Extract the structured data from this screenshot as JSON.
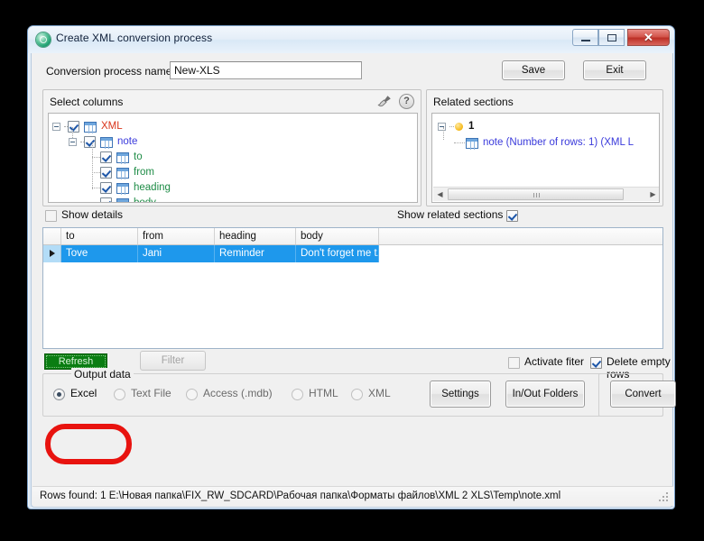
{
  "window": {
    "title": "Create XML conversion process",
    "app_icon": "app-circle-icon",
    "minimize_label": "",
    "maximize_label": "",
    "close_label": "✕"
  },
  "toolbar": {
    "conversion_label": "Conversion process name:",
    "conversion_value": "New-XLS",
    "save_label": "Save",
    "exit_label": "Exit"
  },
  "columns_panel": {
    "header": "Select columns",
    "brush_icon": "brush-icon",
    "help_icon": "help-icon",
    "tree": [
      {
        "label": "XML",
        "color": "#d9341b",
        "depth": 0,
        "checked": true,
        "expanded": true
      },
      {
        "label": "note",
        "color": "#3a3adb",
        "depth": 1,
        "checked": true,
        "expanded": true
      },
      {
        "label": "to",
        "color": "#1e8c46",
        "depth": 2,
        "checked": true,
        "expanded": false
      },
      {
        "label": "from",
        "color": "#1e8c46",
        "depth": 2,
        "checked": true,
        "expanded": false
      },
      {
        "label": "heading",
        "color": "#1e8c46",
        "depth": 2,
        "checked": true,
        "expanded": false
      },
      {
        "label": "body",
        "color": "#1e8c46",
        "depth": 2,
        "checked": true,
        "expanded": false
      }
    ]
  },
  "related_panel": {
    "header": "Related sections",
    "root_label": "1",
    "child_label": "note (Number of rows: 1) (XML L",
    "scrollbar": {
      "left_arrow": "◀",
      "right_arrow": "▶",
      "grip": "|||"
    }
  },
  "options_row": {
    "show_details_label": "Show details",
    "show_details_checked": false,
    "show_related_label": "Show related sections",
    "show_related_checked": true
  },
  "grid": {
    "columns": [
      "to",
      "from",
      "heading",
      "body"
    ],
    "rows": [
      {
        "selected": true,
        "cells": [
          "Tove",
          "Jani",
          "Reminder",
          "Don't forget me t..."
        ]
      }
    ],
    "row_indicator": "▶"
  },
  "grid_actions": {
    "refresh_label": "Refresh",
    "filter_label": "Filter",
    "activate_filter_label": "Activate fiter",
    "activate_filter_checked": false,
    "delete_empty_label": "Delete empty rows",
    "delete_empty_checked": true
  },
  "output_data": {
    "title": "Output data",
    "options": [
      {
        "label": "Excel",
        "selected": true
      },
      {
        "label": "Text File",
        "selected": false
      },
      {
        "label": "Access (.mdb)",
        "selected": false
      },
      {
        "label": "HTML",
        "selected": false
      },
      {
        "label": "XML",
        "selected": false
      }
    ],
    "settings_label": "Settings",
    "inout_folders_label": "In/Out Folders",
    "convert_label": "Convert"
  },
  "statusbar": {
    "text": "Rows found: 1   E:\\Новая папка\\FIX_RW_SDCARD\\Рабочая папка\\Форматы файлов\\XML 2 XLS\\Temp\\note.xml"
  },
  "annotation": {
    "color": "#e8130f",
    "shape": "rounded-rect-highlight"
  }
}
